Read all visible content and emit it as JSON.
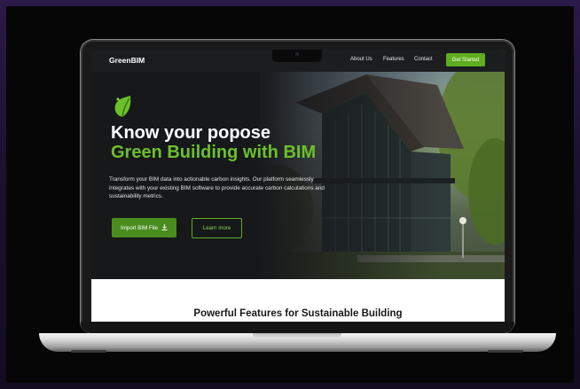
{
  "nav": {
    "brand": "GreenBIM",
    "links": [
      "About Us",
      "Features",
      "Contact"
    ],
    "cta": "Get Started"
  },
  "hero": {
    "title_line1": "Know your popose",
    "title_line2": "Green Building with BIM",
    "description": "Transform your BIM data into actionable carbon insights. Our platform seamlessly integrates with your existing BIM software to provide accurate carbon calculations and sustainability metrics.",
    "primary_button": "Import BIM File",
    "secondary_button": "Learn more"
  },
  "features": {
    "title": "Powerful Features for Sustainable Building"
  },
  "colors": {
    "accent": "#5fae1f",
    "headline_green": "#6cc02a"
  },
  "icons": [
    "leaf-icon",
    "download-icon"
  ]
}
